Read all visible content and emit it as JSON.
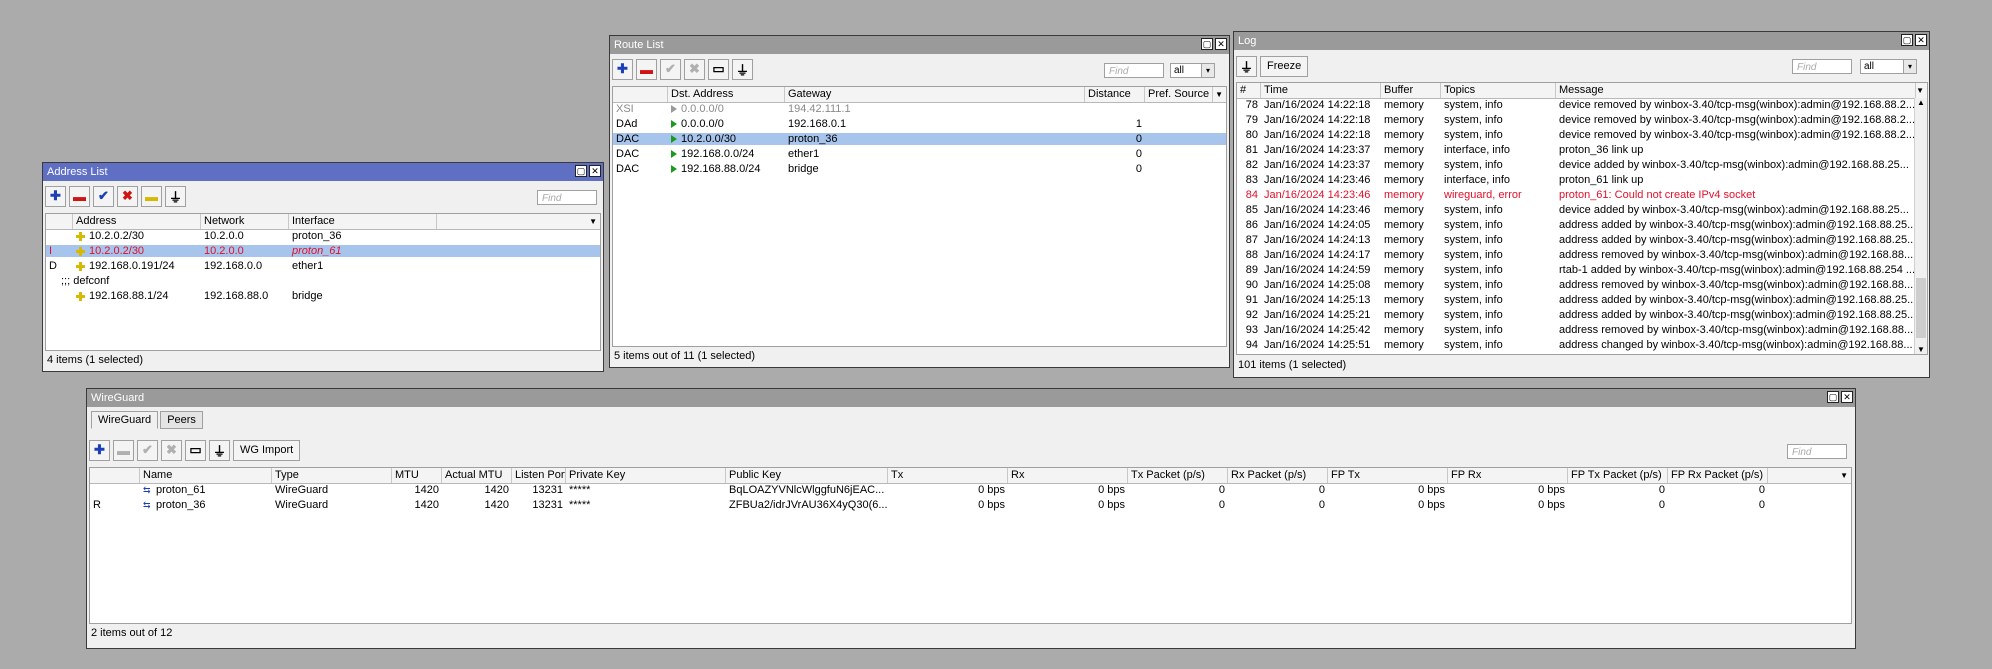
{
  "address_list": {
    "title": "Address List",
    "find_placeholder": "Find",
    "columns": [
      "Address",
      "Network",
      "Interface"
    ],
    "rows": [
      {
        "flag": "",
        "address": "10.2.0.2/30",
        "network": "10.2.0.0",
        "interface": "proton_36"
      },
      {
        "flag": "I",
        "address": "10.2.0.2/30",
        "network": "10.2.0.0",
        "interface": "proton_61"
      },
      {
        "flag": "D",
        "address": "192.168.0.191/24",
        "network": "192.168.0.0",
        "interface": "ether1"
      },
      {
        "flag": "",
        "comment": ";;; defconf"
      },
      {
        "flag": "",
        "address": "192.168.88.1/24",
        "network": "192.168.88.0",
        "interface": "bridge"
      }
    ],
    "status": "4 items (1 selected)"
  },
  "route_list": {
    "title": "Route List",
    "find_placeholder": "Find",
    "filter_value": "all",
    "columns": [
      "Dst. Address",
      "Gateway",
      "Distance",
      "Pref. Source"
    ],
    "rows": [
      {
        "flag": "XSI",
        "dst": "0.0.0.0/0",
        "gateway": "194.42.111.1",
        "distance": ""
      },
      {
        "flag": "DAd",
        "dst": "0.0.0.0/0",
        "gateway": "192.168.0.1",
        "distance": "1"
      },
      {
        "flag": "DAC",
        "dst": "10.2.0.0/30",
        "gateway": "proton_36",
        "distance": "0"
      },
      {
        "flag": "DAC",
        "dst": "192.168.0.0/24",
        "gateway": "ether1",
        "distance": "0"
      },
      {
        "flag": "DAC",
        "dst": "192.168.88.0/24",
        "gateway": "bridge",
        "distance": "0"
      }
    ],
    "status": "5 items out of 11 (1 selected)"
  },
  "log": {
    "title": "Log",
    "freeze_label": "Freeze",
    "find_placeholder": "Find",
    "filter_value": "all",
    "columns": [
      "#",
      "Time",
      "Buffer",
      "Topics",
      "Message"
    ],
    "rows": [
      {
        "n": "78",
        "time": "Jan/16/2024 14:22:18",
        "buffer": "memory",
        "topics": "system, info",
        "message": "device removed by winbox-3.40/tcp-msg(winbox):admin@192.168.88.2..."
      },
      {
        "n": "79",
        "time": "Jan/16/2024 14:22:18",
        "buffer": "memory",
        "topics": "system, info",
        "message": "device removed by winbox-3.40/tcp-msg(winbox):admin@192.168.88.2..."
      },
      {
        "n": "80",
        "time": "Jan/16/2024 14:22:18",
        "buffer": "memory",
        "topics": "system, info",
        "message": "device removed by winbox-3.40/tcp-msg(winbox):admin@192.168.88.2..."
      },
      {
        "n": "81",
        "time": "Jan/16/2024 14:23:37",
        "buffer": "memory",
        "topics": "interface, info",
        "message": "proton_36 link up"
      },
      {
        "n": "82",
        "time": "Jan/16/2024 14:23:37",
        "buffer": "memory",
        "topics": "system, info",
        "message": "device added by winbox-3.40/tcp-msg(winbox):admin@192.168.88.25..."
      },
      {
        "n": "83",
        "time": "Jan/16/2024 14:23:46",
        "buffer": "memory",
        "topics": "interface, info",
        "message": "proton_61 link up"
      },
      {
        "n": "84",
        "time": "Jan/16/2024 14:23:46",
        "buffer": "memory",
        "topics": "wireguard, error",
        "message": "proton_61: Could not create IPv4 socket",
        "error": true
      },
      {
        "n": "85",
        "time": "Jan/16/2024 14:23:46",
        "buffer": "memory",
        "topics": "system, info",
        "message": "device added by winbox-3.40/tcp-msg(winbox):admin@192.168.88.25..."
      },
      {
        "n": "86",
        "time": "Jan/16/2024 14:24:05",
        "buffer": "memory",
        "topics": "system, info",
        "message": "address added by winbox-3.40/tcp-msg(winbox):admin@192.168.88.25..."
      },
      {
        "n": "87",
        "time": "Jan/16/2024 14:24:13",
        "buffer": "memory",
        "topics": "system, info",
        "message": "address added by winbox-3.40/tcp-msg(winbox):admin@192.168.88.25..."
      },
      {
        "n": "88",
        "time": "Jan/16/2024 14:24:17",
        "buffer": "memory",
        "topics": "system, info",
        "message": "address removed by winbox-3.40/tcp-msg(winbox):admin@192.168.88..."
      },
      {
        "n": "89",
        "time": "Jan/16/2024 14:24:59",
        "buffer": "memory",
        "topics": "system, info",
        "message": "rtab-1 added by winbox-3.40/tcp-msg(winbox):admin@192.168.88.254 ..."
      },
      {
        "n": "90",
        "time": "Jan/16/2024 14:25:08",
        "buffer": "memory",
        "topics": "system, info",
        "message": "address removed by winbox-3.40/tcp-msg(winbox):admin@192.168.88..."
      },
      {
        "n": "91",
        "time": "Jan/16/2024 14:25:13",
        "buffer": "memory",
        "topics": "system, info",
        "message": "address added by winbox-3.40/tcp-msg(winbox):admin@192.168.88.25..."
      },
      {
        "n": "92",
        "time": "Jan/16/2024 14:25:21",
        "buffer": "memory",
        "topics": "system, info",
        "message": "address added by winbox-3.40/tcp-msg(winbox):admin@192.168.88.25..."
      },
      {
        "n": "93",
        "time": "Jan/16/2024 14:25:42",
        "buffer": "memory",
        "topics": "system, info",
        "message": "address removed by winbox-3.40/tcp-msg(winbox):admin@192.168.88..."
      },
      {
        "n": "94",
        "time": "Jan/16/2024 14:25:51",
        "buffer": "memory",
        "topics": "system, info",
        "message": "address changed by winbox-3.40/tcp-msg(winbox):admin@192.168.88..."
      }
    ],
    "status": "101 items (1 selected)"
  },
  "wireguard": {
    "title": "WireGuard",
    "tabs": [
      "WireGuard",
      "Peers"
    ],
    "wg_import_label": "WG Import",
    "find_placeholder": "Find",
    "columns": [
      "Name",
      "Type",
      "MTU",
      "Actual MTU",
      "Listen Port",
      "Private Key",
      "Public Key",
      "Tx",
      "Rx",
      "Tx Packet (p/s)",
      "Rx Packet (p/s)",
      "FP Tx",
      "FP Rx",
      "FP Tx Packet (p/s)",
      "FP Rx Packet (p/s)"
    ],
    "rows": [
      {
        "flag": "",
        "name": "proton_61",
        "type": "WireGuard",
        "mtu": "1420",
        "actual_mtu": "1420",
        "listen_port": "13231",
        "private_key": "*****",
        "public_key": "BqLOAZYVNlcWlggfuN6jEAC...",
        "tx": "0 bps",
        "rx": "0 bps",
        "tx_pps": "0",
        "rx_pps": "0",
        "fp_tx": "0 bps",
        "fp_rx": "0 bps",
        "fp_tx_pps": "0",
        "fp_rx_pps": "0"
      },
      {
        "flag": "R",
        "name": "proton_36",
        "type": "WireGuard",
        "mtu": "1420",
        "actual_mtu": "1420",
        "listen_port": "13231",
        "private_key": "*****",
        "public_key": "ZFBUa2/idrJVrAU36X4yQ30(6...",
        "tx": "0 bps",
        "rx": "0 bps",
        "tx_pps": "0",
        "rx_pps": "0",
        "fp_tx": "0 bps",
        "fp_rx": "0 bps",
        "fp_tx_pps": "0",
        "fp_rx_pps": "0"
      }
    ],
    "status": "2 items out of 12"
  },
  "colors": {
    "desktop": "#ababab",
    "active_title": "#5e6fc4",
    "inactive_title": "#9a9a9a",
    "selection": "#a7c4ec",
    "error_text": "#e0102a"
  }
}
